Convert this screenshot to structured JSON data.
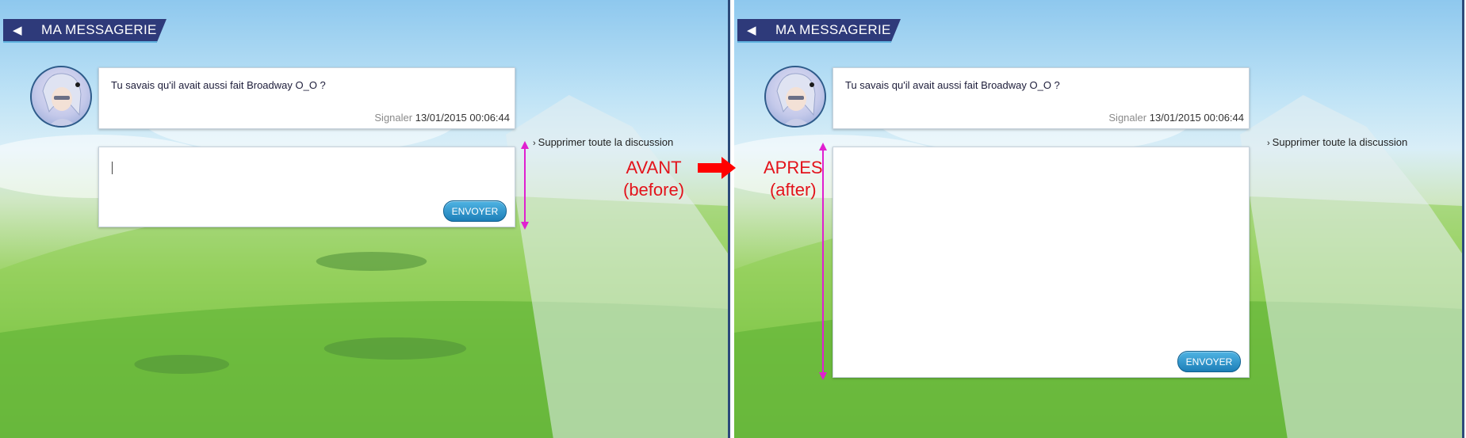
{
  "header": {
    "back_icon": "back-arrow-icon",
    "title": "MA MESSAGERIE"
  },
  "message": {
    "text": "Tu savais qu'il avait aussi fait Broadway O_O ?",
    "report_label": "Signaler",
    "timestamp": "13/01/2015 00:06:44"
  },
  "delete_label": "Supprimer toute la discussion",
  "reply": {
    "send_label": "ENVOYER"
  },
  "annotations": {
    "before_label": "AVANT",
    "before_sub": "(before)",
    "after_label": "APRES",
    "after_sub": "(after)",
    "arrow_color": "#ff0000",
    "measure_color": "#e020d0"
  },
  "colors": {
    "header_bg": "#2e3a7a",
    "button": "#1d7fb8"
  }
}
